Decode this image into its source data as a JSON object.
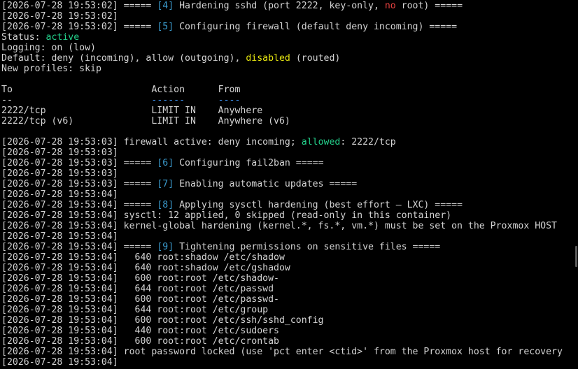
{
  "terminal": {
    "lines": [
      {
        "segments": [
          {
            "text": "[2026-07-28 19:53:02] ===== "
          },
          {
            "text": "[4]",
            "color": "cyan"
          },
          {
            "text": " Hardening sshd (port 2222, key-only, "
          },
          {
            "text": "no",
            "color": "red"
          },
          {
            "text": " root) ====="
          }
        ]
      },
      {
        "segments": [
          {
            "text": "[2026-07-28 19:53:02]"
          }
        ]
      },
      {
        "segments": [
          {
            "text": "[2026-07-28 19:53:02] ===== "
          },
          {
            "text": "[5]",
            "color": "cyan"
          },
          {
            "text": " Configuring firewall (default deny incoming) ====="
          }
        ]
      },
      {
        "segments": [
          {
            "text": "Status: "
          },
          {
            "text": "active",
            "color": "green"
          }
        ]
      },
      {
        "segments": [
          {
            "text": "Logging: on (low)"
          }
        ]
      },
      {
        "segments": [
          {
            "text": "Default: deny (incoming), allow (outgoing), "
          },
          {
            "text": "disabled",
            "color": "yellow"
          },
          {
            "text": " (routed)"
          }
        ]
      },
      {
        "segments": [
          {
            "text": "New profiles: skip"
          }
        ]
      },
      {
        "segments": [
          {
            "text": ""
          }
        ]
      },
      {
        "segments": [
          {
            "text": "To                         Action      From"
          }
        ]
      },
      {
        "segments": [
          {
            "text": "--                         "
          },
          {
            "text": "------",
            "color": "blue"
          },
          {
            "text": "      "
          },
          {
            "text": "----",
            "color": "blue"
          }
        ]
      },
      {
        "segments": [
          {
            "text": "2222/tcp                   LIMIT IN    Anywhere"
          }
        ]
      },
      {
        "segments": [
          {
            "text": "2222/tcp (v6)              LIMIT IN    Anywhere (v6)"
          }
        ]
      },
      {
        "segments": [
          {
            "text": ""
          }
        ]
      },
      {
        "segments": [
          {
            "text": "[2026-07-28 19:53:03] firewall active: deny incoming; "
          },
          {
            "text": "allowed",
            "color": "green"
          },
          {
            "text": ": 2222/tcp"
          }
        ]
      },
      {
        "segments": [
          {
            "text": "[2026-07-28 19:53:03]"
          }
        ]
      },
      {
        "segments": [
          {
            "text": "[2026-07-28 19:53:03] ===== "
          },
          {
            "text": "[6]",
            "color": "cyan"
          },
          {
            "text": " Configuring fail2ban ====="
          }
        ]
      },
      {
        "segments": [
          {
            "text": "[2026-07-28 19:53:03]"
          }
        ]
      },
      {
        "segments": [
          {
            "text": "[2026-07-28 19:53:03] ===== "
          },
          {
            "text": "[7]",
            "color": "cyan"
          },
          {
            "text": " Enabling automatic updates ====="
          }
        ]
      },
      {
        "segments": [
          {
            "text": "[2026-07-28 19:53:04]"
          }
        ]
      },
      {
        "segments": [
          {
            "text": "[2026-07-28 19:53:04] ===== "
          },
          {
            "text": "[8]",
            "color": "cyan"
          },
          {
            "text": " Applying sysctl hardening (best effort — LXC) ====="
          }
        ]
      },
      {
        "segments": [
          {
            "text": "[2026-07-28 19:53:04] sysctl: 12 applied, 0 skipped (read-only in this container)"
          }
        ]
      },
      {
        "segments": [
          {
            "text": "[2026-07-28 19:53:04] kernel-global hardening (kernel.*, fs.*, vm.*) must be set on the Proxmox HOST"
          }
        ]
      },
      {
        "segments": [
          {
            "text": "[2026-07-28 19:53:04]"
          }
        ]
      },
      {
        "segments": [
          {
            "text": "[2026-07-28 19:53:04] ===== "
          },
          {
            "text": "[9]",
            "color": "cyan"
          },
          {
            "text": " Tightening permissions on sensitive files ====="
          }
        ]
      },
      {
        "segments": [
          {
            "text": "[2026-07-28 19:53:04]   640 root:shadow /etc/shadow"
          }
        ]
      },
      {
        "segments": [
          {
            "text": "[2026-07-28 19:53:04]   640 root:shadow /etc/gshadow"
          }
        ]
      },
      {
        "segments": [
          {
            "text": "[2026-07-28 19:53:04]   600 root:root /etc/shadow-"
          }
        ]
      },
      {
        "segments": [
          {
            "text": "[2026-07-28 19:53:04]   644 root:root /etc/passwd"
          }
        ]
      },
      {
        "segments": [
          {
            "text": "[2026-07-28 19:53:04]   600 root:root /etc/passwd-"
          }
        ]
      },
      {
        "segments": [
          {
            "text": "[2026-07-28 19:53:04]   644 root:root /etc/group"
          }
        ]
      },
      {
        "segments": [
          {
            "text": "[2026-07-28 19:53:04]   600 root:root /etc/ssh/sshd_config"
          }
        ]
      },
      {
        "segments": [
          {
            "text": "[2026-07-28 19:53:04]   440 root:root /etc/sudoers"
          }
        ]
      },
      {
        "segments": [
          {
            "text": "[2026-07-28 19:53:04]   600 root:root /etc/crontab"
          }
        ]
      },
      {
        "segments": [
          {
            "text": "[2026-07-28 19:53:04] root password locked (use 'pct enter <ctid>' from the Proxmox host for recovery"
          }
        ]
      },
      {
        "segments": [
          {
            "text": "[2026-07-28 19:53:04]"
          }
        ]
      }
    ]
  },
  "colors": {
    "background": "#000000",
    "foreground": "#d4d4d4",
    "cyan": "#3b9ccf",
    "red": "#e5403f",
    "green": "#23d18b",
    "yellow": "#e5e510",
    "blue": "#3b8eea",
    "scrollbar": "#5a5a5a"
  }
}
